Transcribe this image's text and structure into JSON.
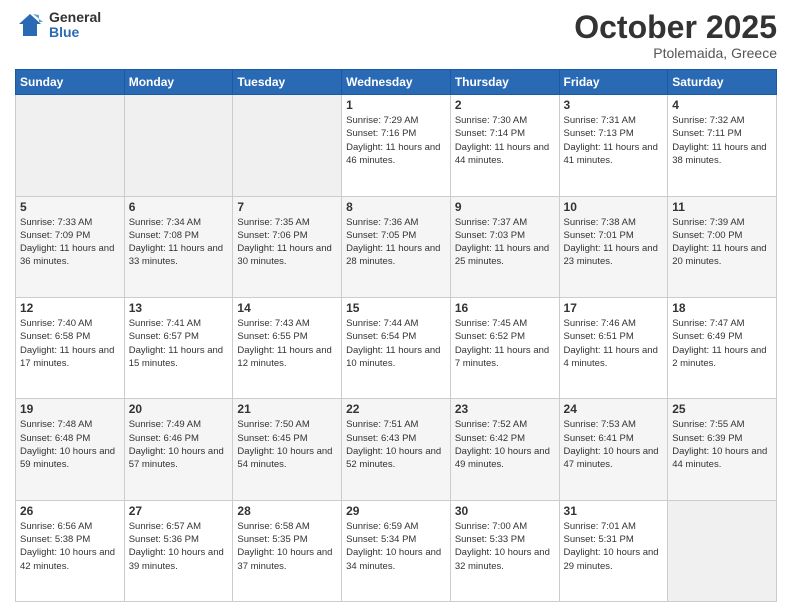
{
  "header": {
    "logo": {
      "general": "General",
      "blue": "Blue"
    },
    "title": "October 2025",
    "location": "Ptolemaida, Greece"
  },
  "weekdays": [
    "Sunday",
    "Monday",
    "Tuesday",
    "Wednesday",
    "Thursday",
    "Friday",
    "Saturday"
  ],
  "weeks": [
    [
      {
        "day": "",
        "empty": true
      },
      {
        "day": "",
        "empty": true
      },
      {
        "day": "",
        "empty": true
      },
      {
        "day": "1",
        "sunrise": "7:29 AM",
        "sunset": "7:16 PM",
        "daylight": "11 hours and 46 minutes."
      },
      {
        "day": "2",
        "sunrise": "7:30 AM",
        "sunset": "7:14 PM",
        "daylight": "11 hours and 44 minutes."
      },
      {
        "day": "3",
        "sunrise": "7:31 AM",
        "sunset": "7:13 PM",
        "daylight": "11 hours and 41 minutes."
      },
      {
        "day": "4",
        "sunrise": "7:32 AM",
        "sunset": "7:11 PM",
        "daylight": "11 hours and 38 minutes."
      }
    ],
    [
      {
        "day": "5",
        "sunrise": "7:33 AM",
        "sunset": "7:09 PM",
        "daylight": "11 hours and 36 minutes."
      },
      {
        "day": "6",
        "sunrise": "7:34 AM",
        "sunset": "7:08 PM",
        "daylight": "11 hours and 33 minutes."
      },
      {
        "day": "7",
        "sunrise": "7:35 AM",
        "sunset": "7:06 PM",
        "daylight": "11 hours and 30 minutes."
      },
      {
        "day": "8",
        "sunrise": "7:36 AM",
        "sunset": "7:05 PM",
        "daylight": "11 hours and 28 minutes."
      },
      {
        "day": "9",
        "sunrise": "7:37 AM",
        "sunset": "7:03 PM",
        "daylight": "11 hours and 25 minutes."
      },
      {
        "day": "10",
        "sunrise": "7:38 AM",
        "sunset": "7:01 PM",
        "daylight": "11 hours and 23 minutes."
      },
      {
        "day": "11",
        "sunrise": "7:39 AM",
        "sunset": "7:00 PM",
        "daylight": "11 hours and 20 minutes."
      }
    ],
    [
      {
        "day": "12",
        "sunrise": "7:40 AM",
        "sunset": "6:58 PM",
        "daylight": "11 hours and 17 minutes."
      },
      {
        "day": "13",
        "sunrise": "7:41 AM",
        "sunset": "6:57 PM",
        "daylight": "11 hours and 15 minutes."
      },
      {
        "day": "14",
        "sunrise": "7:43 AM",
        "sunset": "6:55 PM",
        "daylight": "11 hours and 12 minutes."
      },
      {
        "day": "15",
        "sunrise": "7:44 AM",
        "sunset": "6:54 PM",
        "daylight": "11 hours and 10 minutes."
      },
      {
        "day": "16",
        "sunrise": "7:45 AM",
        "sunset": "6:52 PM",
        "daylight": "11 hours and 7 minutes."
      },
      {
        "day": "17",
        "sunrise": "7:46 AM",
        "sunset": "6:51 PM",
        "daylight": "11 hours and 4 minutes."
      },
      {
        "day": "18",
        "sunrise": "7:47 AM",
        "sunset": "6:49 PM",
        "daylight": "11 hours and 2 minutes."
      }
    ],
    [
      {
        "day": "19",
        "sunrise": "7:48 AM",
        "sunset": "6:48 PM",
        "daylight": "10 hours and 59 minutes."
      },
      {
        "day": "20",
        "sunrise": "7:49 AM",
        "sunset": "6:46 PM",
        "daylight": "10 hours and 57 minutes."
      },
      {
        "day": "21",
        "sunrise": "7:50 AM",
        "sunset": "6:45 PM",
        "daylight": "10 hours and 54 minutes."
      },
      {
        "day": "22",
        "sunrise": "7:51 AM",
        "sunset": "6:43 PM",
        "daylight": "10 hours and 52 minutes."
      },
      {
        "day": "23",
        "sunrise": "7:52 AM",
        "sunset": "6:42 PM",
        "daylight": "10 hours and 49 minutes."
      },
      {
        "day": "24",
        "sunrise": "7:53 AM",
        "sunset": "6:41 PM",
        "daylight": "10 hours and 47 minutes."
      },
      {
        "day": "25",
        "sunrise": "7:55 AM",
        "sunset": "6:39 PM",
        "daylight": "10 hours and 44 minutes."
      }
    ],
    [
      {
        "day": "26",
        "sunrise": "6:56 AM",
        "sunset": "5:38 PM",
        "daylight": "10 hours and 42 minutes."
      },
      {
        "day": "27",
        "sunrise": "6:57 AM",
        "sunset": "5:36 PM",
        "daylight": "10 hours and 39 minutes."
      },
      {
        "day": "28",
        "sunrise": "6:58 AM",
        "sunset": "5:35 PM",
        "daylight": "10 hours and 37 minutes."
      },
      {
        "day": "29",
        "sunrise": "6:59 AM",
        "sunset": "5:34 PM",
        "daylight": "10 hours and 34 minutes."
      },
      {
        "day": "30",
        "sunrise": "7:00 AM",
        "sunset": "5:33 PM",
        "daylight": "10 hours and 32 minutes."
      },
      {
        "day": "31",
        "sunrise": "7:01 AM",
        "sunset": "5:31 PM",
        "daylight": "10 hours and 29 minutes."
      },
      {
        "day": "",
        "empty": true
      }
    ]
  ]
}
